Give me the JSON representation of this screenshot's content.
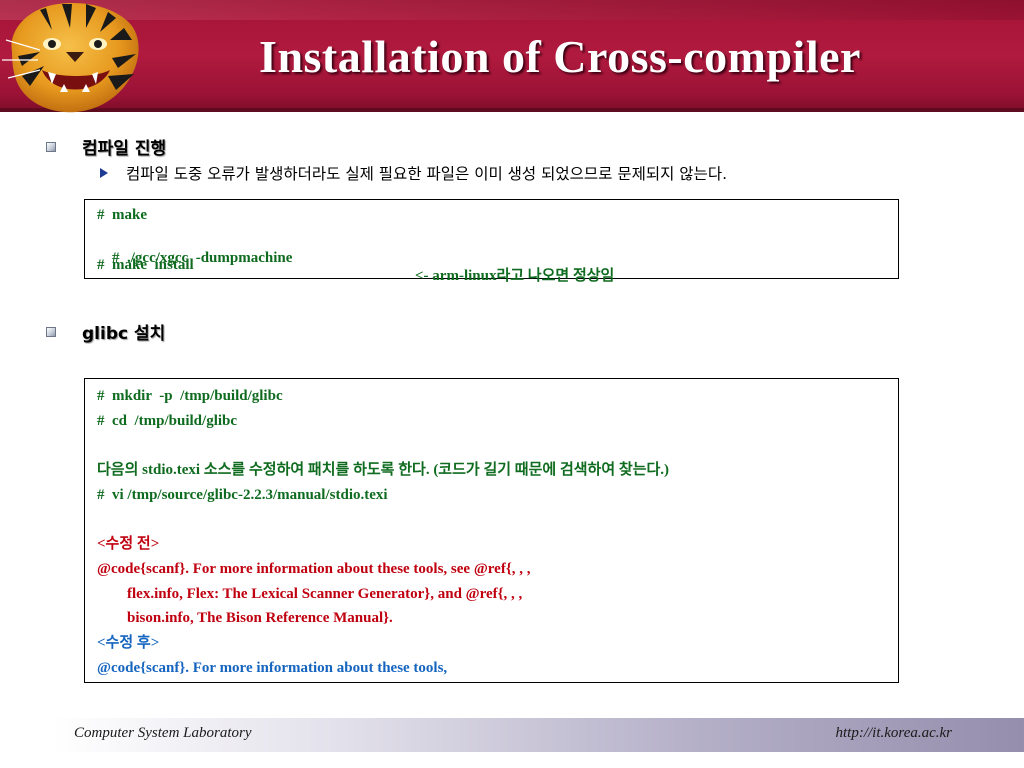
{
  "title": "Installation of Cross-compiler",
  "section1": {
    "heading": "컴파일 진행",
    "sub_bullet": "컴파일 도중 오류가 발생하더라도 실제 필요한 파일은 이미 생성 되었으므로 문제되지 않는다."
  },
  "box1": {
    "line1": "#  make",
    "line2_cmd": "#  ./gcc/xgcc  -dumpmachine",
    "line2_note": "<- arm-linux라고 나오면 정상임",
    "line3": "#  make  install"
  },
  "section2": {
    "heading": "glibc 설치"
  },
  "box2": {
    "mkdir": "#  mkdir  -p  /tmp/build/glibc",
    "cd": "#  cd  /tmp/build/glibc",
    "instruction": "다음의 stdio.texi 소스를 수정하여 패치를 하도록 한다. (코드가 길기 때문에 검색하여 찾는다.)",
    "vi": "#  vi /tmp/source/glibc-2.2.3/manual/stdio.texi",
    "before_label": "<수정 전>",
    "before_line1": "@code{scanf}. For more information about these tools, see @ref{, , ,",
    "before_line2": "        flex.info, Flex: The Lexical Scanner Generator}, and @ref{, , ,",
    "before_line3": "        bison.info, The Bison Reference Manual}.",
    "after_label": "<수정 후>",
    "after_line1": "@code{scanf}. For more information about these tools,"
  },
  "footer": {
    "left": "Computer System Laboratory",
    "right": "http://it.korea.ac.kr"
  },
  "icons": {
    "logo": "tiger-head-logo",
    "bullet_l1": "square-bullet-icon",
    "bullet_l2": "triangle-bullet-icon"
  },
  "colors": {
    "header": "#b01a3e",
    "code_green": "#0f6b1f",
    "code_red": "#c0000f",
    "code_blue": "#1565c0"
  }
}
